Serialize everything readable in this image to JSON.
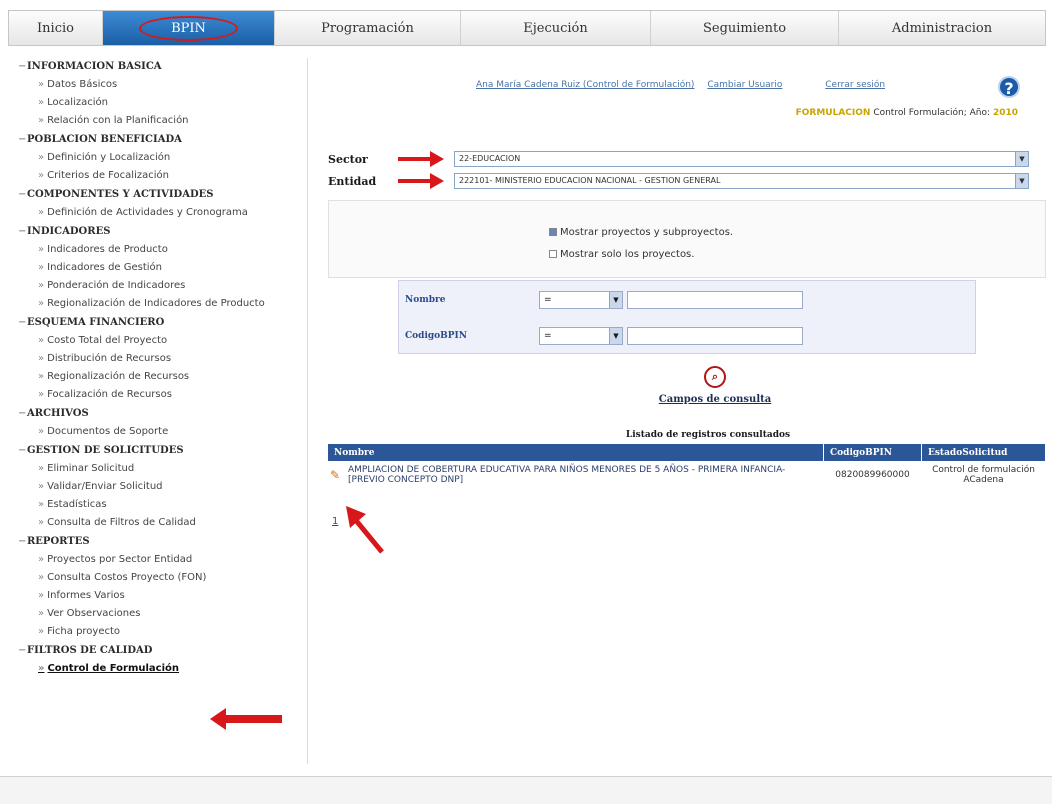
{
  "tabs": [
    {
      "label": "Inicio"
    },
    {
      "label": "BPIN"
    },
    {
      "label": "Programación"
    },
    {
      "label": "Ejecución"
    },
    {
      "label": "Seguimiento"
    },
    {
      "label": "Administracion"
    }
  ],
  "sidebar": {
    "sections": [
      {
        "title": "INFORMACION BASICA",
        "items": [
          "Datos Básicos",
          "Localización",
          "Relación con la Planificación"
        ]
      },
      {
        "title": "POBLACION BENEFICIADA",
        "items": [
          "Definición y Localización",
          "Criterios de Focalización"
        ]
      },
      {
        "title": "COMPONENTES Y ACTIVIDADES",
        "items": [
          "Definición de Actividades y Cronograma"
        ]
      },
      {
        "title": "INDICADORES",
        "items": [
          "Indicadores de Producto",
          "Indicadores de Gestión",
          "Ponderación de Indicadores",
          "Regionalización de Indicadores de Producto"
        ]
      },
      {
        "title": "ESQUEMA FINANCIERO",
        "items": [
          "Costo Total del Proyecto",
          "Distribución de Recursos",
          "Regionalización de Recursos",
          "Focalización de Recursos"
        ]
      },
      {
        "title": "ARCHIVOS",
        "items": [
          "Documentos de Soporte"
        ]
      },
      {
        "title": "GESTION DE SOLICITUDES",
        "items": [
          "Eliminar Solicitud",
          "Validar/Enviar Solicitud",
          "Estadísticas",
          "Consulta de Filtros de Calidad"
        ]
      },
      {
        "title": "REPORTES",
        "items": [
          "Proyectos por Sector Entidad",
          "Consulta Costos Proyecto (FON)",
          "Informes Varios",
          "Ver Observaciones",
          "Ficha proyecto"
        ]
      },
      {
        "title": "FILTROS DE CALIDAD",
        "items": [
          "Control de Formulación"
        ]
      }
    ]
  },
  "header": {
    "user_link": "Ana María Cadena Ruiz (Control de Formulación)",
    "change_user": "Cambiar Usuario",
    "logout": "Cerrar sesión",
    "phase": "FORMULACION",
    "status_text": "Control Formulación; Año:",
    "year": "2010",
    "help_icon": "?"
  },
  "form": {
    "sector_label": "Sector",
    "sector_value": "22-EDUCACION",
    "entidad_label": "Entidad",
    "entidad_value": "222101- MINISTERIO EDUCACION NACIONAL - GESTION GENERAL",
    "option_all": "Mostrar proyectos y subproyectos.",
    "option_projects": "Mostrar solo los proyectos.",
    "nombre_label": "Nombre",
    "nombre_op": "=",
    "codigo_label": "CodigoBPIN",
    "codigo_op": "=",
    "consult_label": "Campos de consulta"
  },
  "results": {
    "title": "Listado de registros consultados",
    "columns": [
      "Nombre",
      "CodigoBPIN",
      "EstadoSolicitud"
    ],
    "rows": [
      {
        "nombre": "AMPLIACION DE COBERTURA EDUCATIVA PARA NIÑOS MENORES DE 5 AÑOS - PRIMERA INFANCIA- [PREVIO CONCEPTO DNP]",
        "codigo": "0820089960000",
        "estado": "Control de formulación ACadena"
      }
    ],
    "page": "1"
  }
}
